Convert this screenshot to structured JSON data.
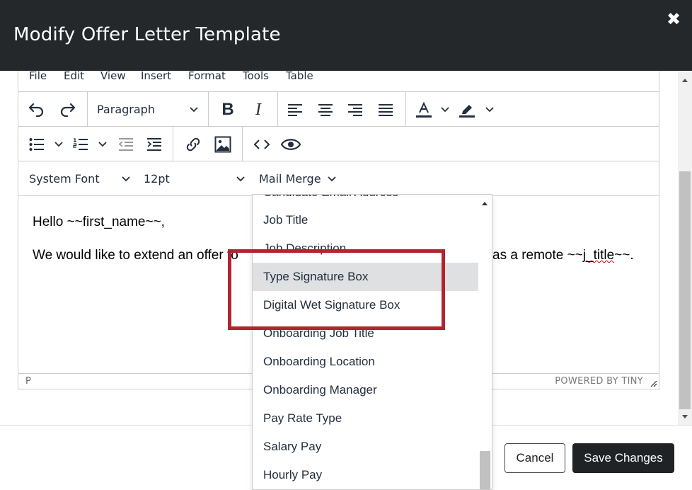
{
  "modal": {
    "title": "Modify Offer Letter Template",
    "close_glyph": "✖"
  },
  "menubar": {
    "items": [
      {
        "label": "File"
      },
      {
        "label": "Edit"
      },
      {
        "label": "View"
      },
      {
        "label": "Insert"
      },
      {
        "label": "Format"
      },
      {
        "label": "Tools"
      },
      {
        "label": "Table"
      }
    ]
  },
  "toolbar": {
    "block_format": "Paragraph",
    "font_family": "System Font",
    "font_size": "12pt",
    "mail_merge": "Mail Merge",
    "text_color": "#222f3e",
    "highlight_color": "#222f3e",
    "icons": [
      "undo-icon",
      "redo-icon",
      "bold-icon",
      "italic-icon",
      "align-left-icon",
      "align-center-icon",
      "align-right-icon",
      "align-justify-icon",
      "text-color-icon",
      "highlight-icon",
      "bullet-list-icon",
      "numbered-list-icon",
      "outdent-icon",
      "indent-icon",
      "link-icon",
      "image-icon",
      "code-icon",
      "preview-icon"
    ],
    "bold_glyph": "B",
    "italic_glyph": "I",
    "code_glyph": "<>"
  },
  "content": {
    "line1": "Hello ~~first_name~~,",
    "line2_before": "We would like to extend an offer to",
    "line2_after": "as a remote ~~",
    "line2_misspelled": "j_title",
    "line2_end": "~~."
  },
  "statusbar": {
    "path": "P",
    "brand": "POWERED BY TINY"
  },
  "mail_merge_menu": {
    "items": [
      {
        "label": "Candidate Email Address"
      },
      {
        "label": "Job Title"
      },
      {
        "label": "Job Description"
      },
      {
        "label": "Type Signature Box",
        "active": true
      },
      {
        "label": "Digital Wet Signature Box"
      },
      {
        "label": "Onboarding Job Title"
      },
      {
        "label": "Onboarding Location"
      },
      {
        "label": "Onboarding Manager"
      },
      {
        "label": "Pay Rate Type"
      },
      {
        "label": "Salary Pay"
      },
      {
        "label": "Hourly Pay"
      }
    ]
  },
  "footer": {
    "cancel_label": "Cancel",
    "save_label": "Save Changes"
  },
  "colors": {
    "header_bg": "#24282b",
    "highlight_border": "#b02530",
    "active_item_bg": "#dee0e2",
    "save_button_bg": "#1f2326"
  }
}
